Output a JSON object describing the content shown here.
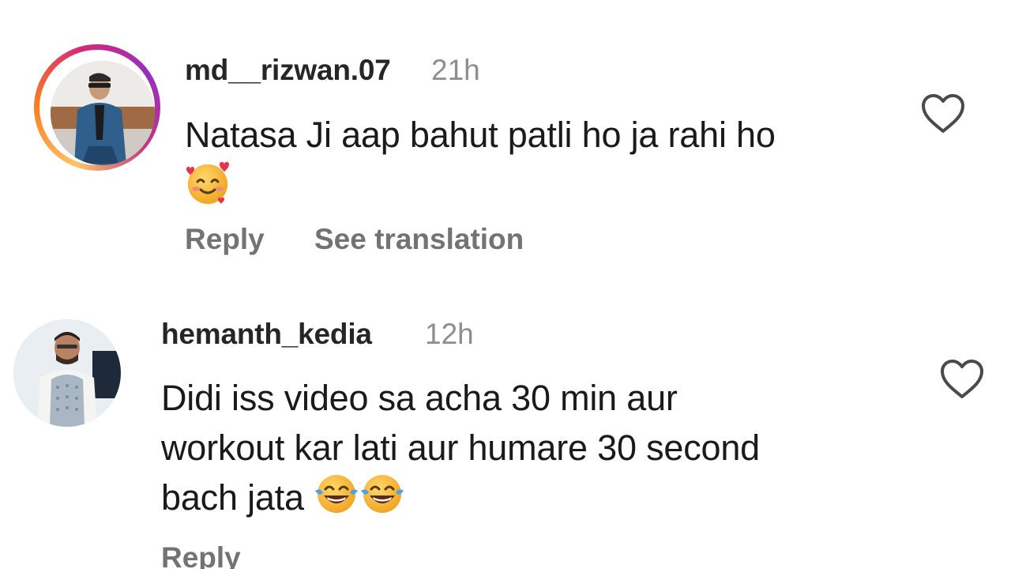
{
  "comments": [
    {
      "username": "md__rizwan.07",
      "timestamp": "21h",
      "text": "Natasa Ji aap bahut patli ho ja rahi ho",
      "emoji": "smiling-face-with-hearts",
      "reply_label": "Reply",
      "see_translation_label": "See translation",
      "has_story_ring": true
    },
    {
      "username": "hemanth_kedia",
      "timestamp": "12h",
      "text_line1": "Didi iss video sa acha 30 min aur",
      "text_line2": "workout kar lati aur humare 30 second",
      "text_line3": "bach jata",
      "emoji": "face-with-tears-of-joy",
      "emoji_count": 2,
      "reply_label": "Reply"
    }
  ],
  "icons": {
    "like": "heart-outline-icon"
  },
  "colors": {
    "username": "#262626",
    "timestamp": "#8e8e8e",
    "action": "#737373",
    "heart_stroke": "#4a4a4a"
  }
}
